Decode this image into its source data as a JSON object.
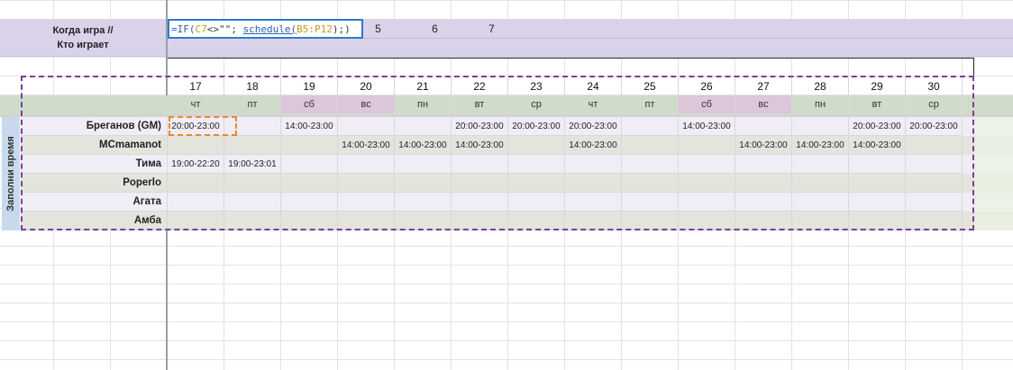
{
  "header": {
    "title_line1": "Когда игра //",
    "title_line2": "Кто играет",
    "col_numbers": [
      "5",
      "6",
      "7"
    ]
  },
  "formula": {
    "fn1": "=IF(",
    "ref1": "C7",
    "op": "<>\"\";",
    "fn2": "schedule(",
    "ref2": "B5:P12",
    "tail": ");)"
  },
  "dates": [
    "17",
    "18",
    "19",
    "20",
    "21",
    "22",
    "23",
    "24",
    "25",
    "26",
    "27",
    "28",
    "29",
    "30"
  ],
  "weekdays": [
    "чт",
    "пт",
    "сб",
    "вс",
    "пн",
    "вт",
    "ср",
    "чт",
    "пт",
    "сб",
    "вс",
    "пн",
    "вт",
    "ср"
  ],
  "weekend_flags": [
    false,
    false,
    true,
    true,
    false,
    false,
    false,
    false,
    false,
    true,
    true,
    false,
    false,
    false
  ],
  "side_label": "Заполни время",
  "players": [
    {
      "name": "Бреганов (GM)",
      "slots": [
        "20:00-23:00",
        "",
        "14:00-23:00",
        "",
        "",
        "20:00-23:00",
        "20:00-23:00",
        "20:00-23:00",
        "",
        "14:00-23:00",
        "",
        "",
        "20:00-23:00",
        "20:00-23:00"
      ]
    },
    {
      "name": "MCmamanot",
      "slots": [
        "",
        "",
        "",
        "14:00-23:00",
        "14:00-23:00",
        "14:00-23:00",
        "",
        "14:00-23:00",
        "",
        "",
        "14:00-23:00",
        "14:00-23:00",
        "14:00-23:00",
        ""
      ]
    },
    {
      "name": "Тима",
      "slots": [
        "19:00-22:20",
        "19:00-23:01",
        "",
        "",
        "",
        "",
        "",
        "",
        "",
        "",
        "",
        "",
        "",
        ""
      ]
    },
    {
      "name": "Poperlo",
      "slots": [
        "",
        "",
        "",
        "",
        "",
        "",
        "",
        "",
        "",
        "",
        "",
        "",
        "",
        ""
      ]
    },
    {
      "name": "Агата",
      "slots": [
        "",
        "",
        "",
        "",
        "",
        "",
        "",
        "",
        "",
        "",
        "",
        "",
        "",
        ""
      ]
    },
    {
      "name": "Амба",
      "slots": [
        "",
        "",
        "",
        "",
        "",
        "",
        "",
        "",
        "",
        "",
        "",
        "",
        "",
        ""
      ]
    }
  ],
  "colors": {
    "header_band": "#d9d2e9",
    "row_lilac": "#f1edf6",
    "row_grey": "#e3e5dc",
    "weekday_band": "#cfdcc9",
    "weekend_cell": "#dcc6da",
    "selection_border": "#7a3e96",
    "active_cell_border": "#e68a2b"
  }
}
